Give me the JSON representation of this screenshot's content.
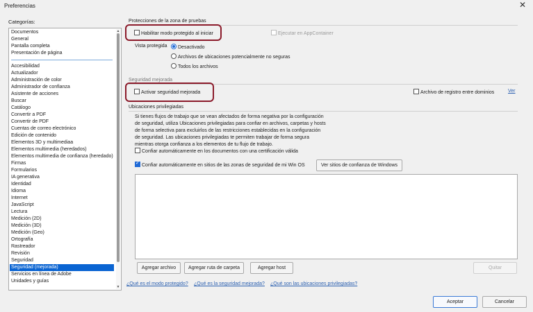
{
  "window": {
    "title": "Preferencias",
    "close_glyph": "✕"
  },
  "categories": {
    "label": "Categorías:",
    "top_items": [
      "Documentos",
      "General",
      "Pantalla completa",
      "Presentación de página"
    ],
    "items": [
      "Accesibilidad",
      "Actualizador",
      "Administración de color",
      "Administrador de confianza",
      "Asistente de acciones",
      "Buscar",
      "Catálogo",
      "Convertir a PDF",
      "Convertir de PDF",
      "Cuentas de correo electrónico",
      "Edición de contenido",
      "Elementos 3D y multimediaa",
      "Elementos multimedia (heredados)",
      "Elementos multimedia de confianza (heredado)",
      "Firmas",
      "Formularios",
      "IA generativa",
      "Identidad",
      "Idioma",
      "Internet",
      "JavaScript",
      "Lectura",
      "Medición (2D)",
      "Medición (3D)",
      "Medición (Geo)",
      "Ortografía",
      "Rastreador",
      "Revisión",
      "Seguridad",
      "Seguridad (mejorada)",
      "Servicios en línea de Adobe",
      "Unidades y guías"
    ],
    "selected": "Seguridad (mejorada)"
  },
  "sandbox": {
    "title": "Protecciones de la zona de pruebas",
    "protected_mode_label": "Habilitar modo protegido al iniciar",
    "protected_mode_checked": false,
    "appcontainer_label": "Ejecutar en AppContainer",
    "view_label": "Vista protegida",
    "options": [
      "Desactivado",
      "Archivos de ubicaciones potencialmente no seguras",
      "Todos los archivos"
    ],
    "selected_option": "Desactivado"
  },
  "enhanced": {
    "title": "Seguridad mejorada",
    "enable_label": "Activar seguridad mejorada",
    "enable_checked": false,
    "log_label": "Archivo de registro entre dominios",
    "view_link": "Ver"
  },
  "privileged": {
    "title": "Ubicaciones privilegiadas",
    "description_lines": [
      "Si tienes flujos de trabajo que se vean afectados de forma negativa por la configuración",
      "de seguridad, utiliza Ubicaciones privilegiadas para confiar en archivos, carpetas y hosts",
      "de forma selectiva para excluirlos de las restricciones establecidas en la configuración",
      "de seguridad. Las ubicaciones privilegiadas te permiten trabajar de forma segura",
      "mientras otorga confianza a los elementos de tu flujo de trabajo."
    ],
    "trust_certified_label": "Confiar automáticamente en los documentos con una certificación válida",
    "trust_certified_checked": false,
    "trust_os_label": "Confiar automáticamente en sitios de las zonas de seguridad de mi Win OS",
    "trust_os_checked": true,
    "view_sites_button": "Ver sitios de confianza de Windows",
    "add_file_button": "Agregar archivo",
    "add_folder_button": "Agregar ruta de carpeta",
    "add_host_button": "Agregar host",
    "remove_button": "Quitar"
  },
  "links": [
    "¿Qué es el modo protegido?",
    "¿Qué es la seguridad mejorada?",
    "¿Qué son las ubicaciones privilegiadas?"
  ],
  "footer": {
    "accept": "Aceptar",
    "cancel": "Cancelar"
  },
  "colors": {
    "selection": "#0a64d2",
    "highlight_box": "#8b1a2a",
    "link": "#2a5fb0",
    "checkbox_on": "#1f6ad6"
  }
}
